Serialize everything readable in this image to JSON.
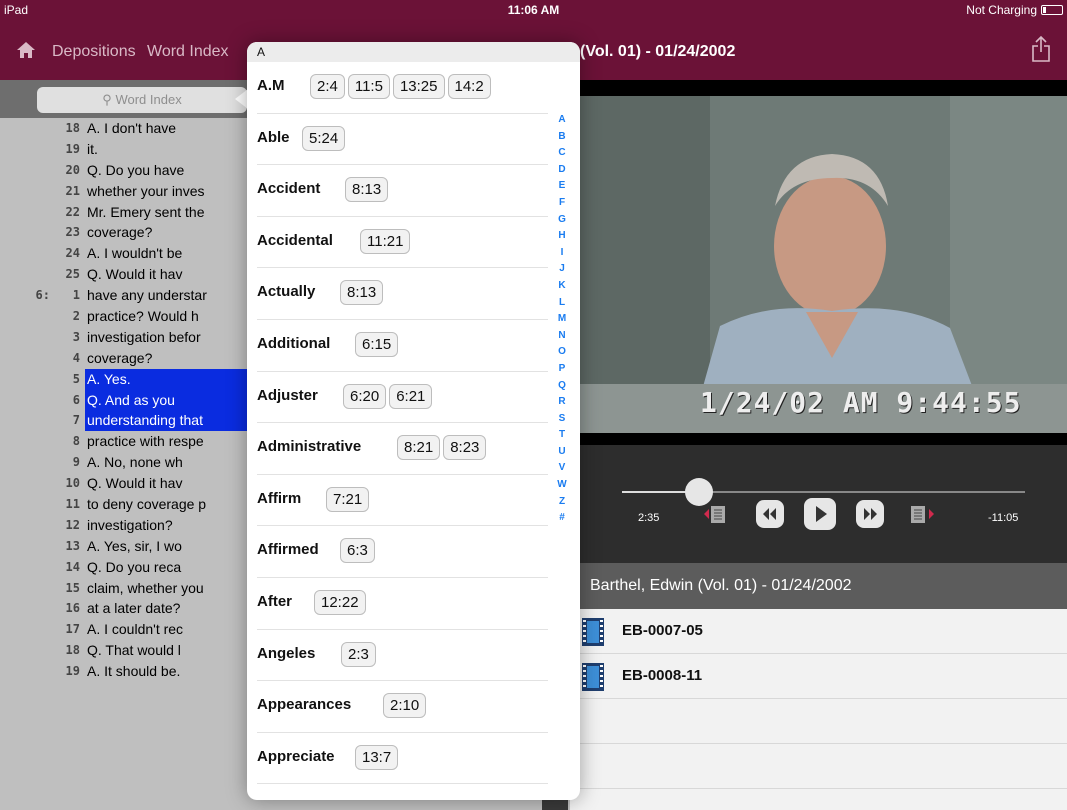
{
  "status": {
    "device": "iPad",
    "time": "11:06 AM",
    "charging": "Not Charging"
  },
  "nav": {
    "crumbs": [
      "Depositions",
      "Word Index"
    ],
    "title": "(Vol. 01) - 01/24/2002"
  },
  "search": {
    "placeholder": "Word Index"
  },
  "transcript": [
    {
      "page": "",
      "line": "18",
      "text": "A.  I don't have",
      "highlight": false
    },
    {
      "page": "",
      "line": "19",
      "text": "it.",
      "highlight": false
    },
    {
      "page": "",
      "line": "20",
      "text": "Q.  Do you have",
      "highlight": false
    },
    {
      "page": "",
      "line": "21",
      "text": "whether your inves",
      "highlight": false
    },
    {
      "page": "",
      "line": "22",
      "text": "Mr. Emery sent the",
      "highlight": false
    },
    {
      "page": "",
      "line": "23",
      "text": "coverage?",
      "highlight": false
    },
    {
      "page": "",
      "line": "24",
      "text": "A.  I wouldn't be",
      "highlight": false
    },
    {
      "page": "",
      "line": "25",
      "text": "Q.  Would it hav",
      "highlight": false
    },
    {
      "page": "6:",
      "line": "1",
      "text": "have any understar",
      "highlight": false
    },
    {
      "page": "",
      "line": "2",
      "text": "practice? Would h",
      "highlight": false
    },
    {
      "page": "",
      "line": "3",
      "text": "investigation befor",
      "highlight": false
    },
    {
      "page": "",
      "line": "4",
      "text": "coverage?",
      "highlight": false
    },
    {
      "page": "",
      "line": "5",
      "text": "A.  Yes.",
      "highlight": true
    },
    {
      "page": "",
      "line": "6",
      "text": "Q.  And as you",
      "highlight": true
    },
    {
      "page": "",
      "line": "7",
      "text": "understanding that",
      "highlight": true
    },
    {
      "page": "",
      "line": "8",
      "text": "practice with respe",
      "highlight": false
    },
    {
      "page": "",
      "line": "9",
      "text": "A.  No, none wh",
      "highlight": false
    },
    {
      "page": "",
      "line": "10",
      "text": "Q.  Would it hav",
      "highlight": false
    },
    {
      "page": "",
      "line": "11",
      "text": "to deny coverage p",
      "highlight": false
    },
    {
      "page": "",
      "line": "12",
      "text": "investigation?",
      "highlight": false
    },
    {
      "page": "",
      "line": "13",
      "text": "A.  Yes, sir, I wo",
      "highlight": false
    },
    {
      "page": "",
      "line": "14",
      "text": "Q.  Do you reca",
      "highlight": false
    },
    {
      "page": "",
      "line": "15",
      "text": "claim, whether you",
      "highlight": false
    },
    {
      "page": "",
      "line": "16",
      "text": "at a later date?",
      "highlight": false
    },
    {
      "page": "",
      "line": "17",
      "text": "A.  I couldn't rec",
      "highlight": false
    },
    {
      "page": "",
      "line": "18",
      "text": "Q.  That would l",
      "highlight": false
    },
    {
      "page": "",
      "line": "19",
      "text": "A.  It should be.",
      "highlight": false
    }
  ],
  "video": {
    "overlay_timestamp": "1/24/02  AM 9:44:55"
  },
  "player": {
    "elapsed": "2:35",
    "remaining": "-11:05",
    "progress": 0.19
  },
  "files": {
    "header": "Barthel, Edwin (Vol. 01) - 01/24/2002",
    "items": [
      "EB-0007-05",
      "EB-0008-11"
    ]
  },
  "word_index": {
    "section": "A",
    "entries": [
      {
        "word": "A.M",
        "refs": [
          "2:4",
          "11:5",
          "13:25",
          "14:2"
        ]
      },
      {
        "word": "Able",
        "refs": [
          "5:24"
        ]
      },
      {
        "word": "Accident",
        "refs": [
          "8:13"
        ]
      },
      {
        "word": "Accidental",
        "refs": [
          "11:21"
        ]
      },
      {
        "word": "Actually",
        "refs": [
          "8:13"
        ]
      },
      {
        "word": "Additional",
        "refs": [
          "6:15"
        ]
      },
      {
        "word": "Adjuster",
        "refs": [
          "6:20",
          "6:21"
        ]
      },
      {
        "word": "Administrative",
        "refs": [
          "8:21",
          "8:23"
        ]
      },
      {
        "word": "Affirm",
        "refs": [
          "7:21"
        ]
      },
      {
        "word": "Affirmed",
        "refs": [
          "6:3"
        ]
      },
      {
        "word": "After",
        "refs": [
          "12:22"
        ]
      },
      {
        "word": "Angeles",
        "refs": [
          "2:3"
        ]
      },
      {
        "word": "Appearances",
        "refs": [
          "2:10"
        ]
      },
      {
        "word": "Appreciate",
        "refs": [
          "13:7"
        ]
      }
    ],
    "alphabet": [
      "A",
      "B",
      "C",
      "D",
      "E",
      "F",
      "G",
      "H",
      "I",
      "J",
      "K",
      "L",
      "M",
      "N",
      "O",
      "P",
      "Q",
      "R",
      "S",
      "T",
      "U",
      "V",
      "W",
      "Z",
      "#"
    ]
  },
  "colors": {
    "brand": "#6b1237",
    "highlight": "#0a2ce0",
    "index_link": "#1a7cf0"
  }
}
